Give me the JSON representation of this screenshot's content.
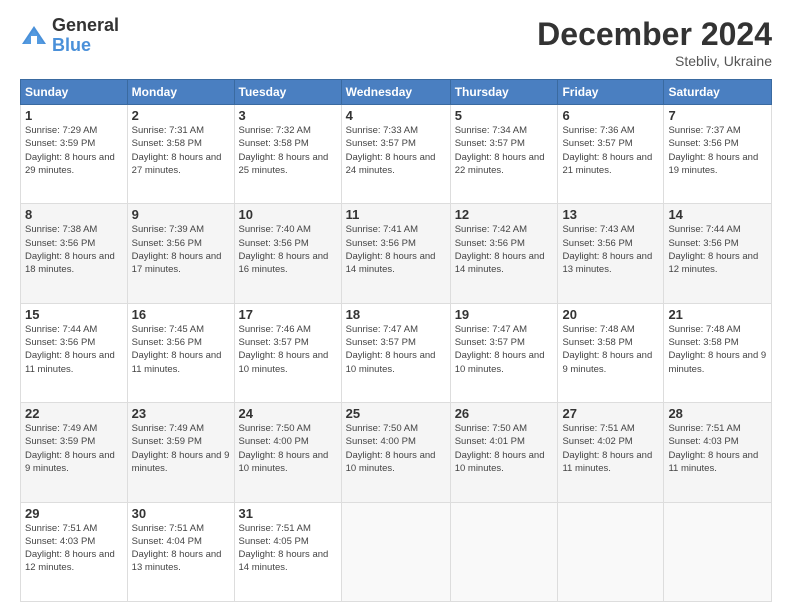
{
  "logo": {
    "general": "General",
    "blue": "Blue"
  },
  "title": "December 2024",
  "subtitle": "Stebliv, Ukraine",
  "days_header": [
    "Sunday",
    "Monday",
    "Tuesday",
    "Wednesday",
    "Thursday",
    "Friday",
    "Saturday"
  ],
  "weeks": [
    [
      {
        "day": "1",
        "sunrise": "7:29 AM",
        "sunset": "3:59 PM",
        "daylight": "8 hours and 29 minutes."
      },
      {
        "day": "2",
        "sunrise": "7:31 AM",
        "sunset": "3:58 PM",
        "daylight": "8 hours and 27 minutes."
      },
      {
        "day": "3",
        "sunrise": "7:32 AM",
        "sunset": "3:58 PM",
        "daylight": "8 hours and 25 minutes."
      },
      {
        "day": "4",
        "sunrise": "7:33 AM",
        "sunset": "3:57 PM",
        "daylight": "8 hours and 24 minutes."
      },
      {
        "day": "5",
        "sunrise": "7:34 AM",
        "sunset": "3:57 PM",
        "daylight": "8 hours and 22 minutes."
      },
      {
        "day": "6",
        "sunrise": "7:36 AM",
        "sunset": "3:57 PM",
        "daylight": "8 hours and 21 minutes."
      },
      {
        "day": "7",
        "sunrise": "7:37 AM",
        "sunset": "3:56 PM",
        "daylight": "8 hours and 19 minutes."
      }
    ],
    [
      {
        "day": "8",
        "sunrise": "7:38 AM",
        "sunset": "3:56 PM",
        "daylight": "8 hours and 18 minutes."
      },
      {
        "day": "9",
        "sunrise": "7:39 AM",
        "sunset": "3:56 PM",
        "daylight": "8 hours and 17 minutes."
      },
      {
        "day": "10",
        "sunrise": "7:40 AM",
        "sunset": "3:56 PM",
        "daylight": "8 hours and 16 minutes."
      },
      {
        "day": "11",
        "sunrise": "7:41 AM",
        "sunset": "3:56 PM",
        "daylight": "8 hours and 14 minutes."
      },
      {
        "day": "12",
        "sunrise": "7:42 AM",
        "sunset": "3:56 PM",
        "daylight": "8 hours and 14 minutes."
      },
      {
        "day": "13",
        "sunrise": "7:43 AM",
        "sunset": "3:56 PM",
        "daylight": "8 hours and 13 minutes."
      },
      {
        "day": "14",
        "sunrise": "7:44 AM",
        "sunset": "3:56 PM",
        "daylight": "8 hours and 12 minutes."
      }
    ],
    [
      {
        "day": "15",
        "sunrise": "7:44 AM",
        "sunset": "3:56 PM",
        "daylight": "8 hours and 11 minutes."
      },
      {
        "day": "16",
        "sunrise": "7:45 AM",
        "sunset": "3:56 PM",
        "daylight": "8 hours and 11 minutes."
      },
      {
        "day": "17",
        "sunrise": "7:46 AM",
        "sunset": "3:57 PM",
        "daylight": "8 hours and 10 minutes."
      },
      {
        "day": "18",
        "sunrise": "7:47 AM",
        "sunset": "3:57 PM",
        "daylight": "8 hours and 10 minutes."
      },
      {
        "day": "19",
        "sunrise": "7:47 AM",
        "sunset": "3:57 PM",
        "daylight": "8 hours and 10 minutes."
      },
      {
        "day": "20",
        "sunrise": "7:48 AM",
        "sunset": "3:58 PM",
        "daylight": "8 hours and 9 minutes."
      },
      {
        "day": "21",
        "sunrise": "7:48 AM",
        "sunset": "3:58 PM",
        "daylight": "8 hours and 9 minutes."
      }
    ],
    [
      {
        "day": "22",
        "sunrise": "7:49 AM",
        "sunset": "3:59 PM",
        "daylight": "8 hours and 9 minutes."
      },
      {
        "day": "23",
        "sunrise": "7:49 AM",
        "sunset": "3:59 PM",
        "daylight": "8 hours and 9 minutes."
      },
      {
        "day": "24",
        "sunrise": "7:50 AM",
        "sunset": "4:00 PM",
        "daylight": "8 hours and 10 minutes."
      },
      {
        "day": "25",
        "sunrise": "7:50 AM",
        "sunset": "4:00 PM",
        "daylight": "8 hours and 10 minutes."
      },
      {
        "day": "26",
        "sunrise": "7:50 AM",
        "sunset": "4:01 PM",
        "daylight": "8 hours and 10 minutes."
      },
      {
        "day": "27",
        "sunrise": "7:51 AM",
        "sunset": "4:02 PM",
        "daylight": "8 hours and 11 minutes."
      },
      {
        "day": "28",
        "sunrise": "7:51 AM",
        "sunset": "4:03 PM",
        "daylight": "8 hours and 11 minutes."
      }
    ],
    [
      {
        "day": "29",
        "sunrise": "7:51 AM",
        "sunset": "4:03 PM",
        "daylight": "8 hours and 12 minutes."
      },
      {
        "day": "30",
        "sunrise": "7:51 AM",
        "sunset": "4:04 PM",
        "daylight": "8 hours and 13 minutes."
      },
      {
        "day": "31",
        "sunrise": "7:51 AM",
        "sunset": "4:05 PM",
        "daylight": "8 hours and 14 minutes."
      },
      null,
      null,
      null,
      null
    ]
  ]
}
